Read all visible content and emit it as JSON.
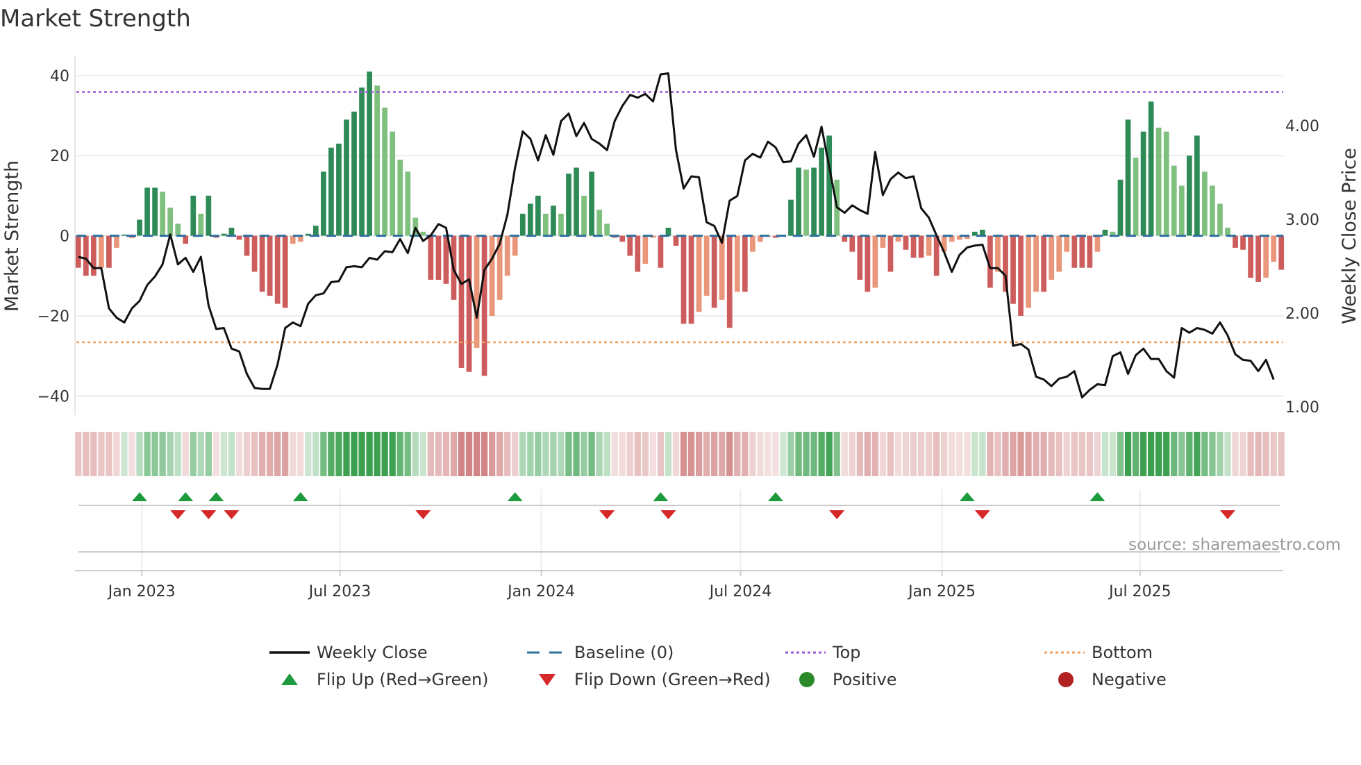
{
  "chart_data": {
    "type": "bar",
    "title": "Market Strength",
    "ylabel": "Market Strength",
    "y2label": "Weekly Close Price",
    "ylim": [
      -44.8,
      45
    ],
    "y2lim": [
      0.91,
      4.75
    ],
    "yticks": [
      40,
      20,
      0,
      -20,
      -40
    ],
    "ytick_labels": [
      "40",
      "20",
      "0",
      "−20",
      "−40"
    ],
    "y2ticks": [
      4,
      3,
      2,
      1
    ],
    "y2tick_labels": [
      "4.00",
      "3.00",
      "2.00",
      "1.00"
    ],
    "start_date": "2022-11-04",
    "frequency": "weekly",
    "xticks": [
      {
        "date": "2023-01-01",
        "label": "Jan 2023"
      },
      {
        "date": "2023-07-01",
        "label": "Jul 2023"
      },
      {
        "date": "2024-01-01",
        "label": "Jan 2024"
      },
      {
        "date": "2024-07-01",
        "label": "Jul 2024"
      },
      {
        "date": "2025-01-01",
        "label": "Jan 2025"
      },
      {
        "date": "2025-07-01",
        "label": "Jul 2025"
      }
    ],
    "top_level": 35.9,
    "bottom_level": -26.6,
    "strength": [
      -8,
      -10,
      -10,
      -8,
      -8,
      -3,
      0.3,
      -0.5,
      4,
      12,
      12,
      11,
      7,
      3,
      -2,
      10,
      5.5,
      10,
      -0.5,
      0.5,
      2,
      -1,
      -5,
      -9,
      -14,
      -15,
      -17,
      -18,
      -2,
      -1.5,
      0.5,
      2.5,
      16,
      22,
      23,
      29,
      31,
      37,
      41,
      37.5,
      32,
      26,
      19,
      16,
      4.5,
      1,
      -11,
      -11,
      -12,
      -16,
      -33,
      -34,
      -28,
      -35,
      -20,
      -16,
      -10,
      -5,
      5.5,
      8,
      10,
      5.5,
      7.5,
      5.5,
      15.5,
      17,
      10,
      16,
      6.5,
      3,
      -0.5,
      -1.5,
      -5,
      -9,
      -7,
      -0.5,
      -8,
      2,
      -2.5,
      -22,
      -22,
      -19,
      -15,
      -18,
      -16,
      -23,
      -14,
      -14,
      -4,
      -1.5,
      -0.3,
      -0.5,
      0.2,
      9,
      17,
      16.5,
      17,
      22,
      25,
      14,
      -1.5,
      -4,
      -11,
      -14,
      -13,
      -3,
      -9,
      -1.5,
      -3.5,
      -5.5,
      -5.5,
      -5,
      -10,
      -4,
      -1.5,
      -1,
      -0.8,
      1,
      1.5,
      -13,
      -9,
      -14,
      -17,
      -20,
      -18,
      -14,
      -14,
      -11,
      -9,
      -4,
      -8,
      -8,
      -8,
      -4,
      1.5,
      1,
      14,
      29,
      19.5,
      26,
      33.5,
      27,
      26,
      17.5,
      12.5,
      20,
      25,
      16,
      12.5,
      8,
      2,
      -3,
      -3.5,
      -10.5,
      -11.5,
      -10.5,
      -6.5,
      -8.5
    ],
    "close": [
      2.6,
      2.58,
      2.48,
      2.48,
      2.05,
      1.95,
      1.9,
      2.05,
      2.13,
      2.3,
      2.39,
      2.52,
      2.84,
      2.52,
      2.59,
      2.44,
      2.6,
      2.08,
      1.83,
      1.84,
      1.62,
      1.59,
      1.35,
      1.2,
      1.19,
      1.19,
      1.45,
      1.84,
      1.9,
      1.86,
      2.1,
      2.19,
      2.21,
      2.33,
      2.34,
      2.49,
      2.5,
      2.49,
      2.59,
      2.57,
      2.66,
      2.65,
      2.79,
      2.64,
      2.91,
      2.77,
      2.83,
      2.95,
      2.91,
      2.46,
      2.31,
      2.36,
      1.95,
      2.46,
      2.58,
      2.74,
      3.05,
      3.55,
      3.94,
      3.86,
      3.63,
      3.9,
      3.69,
      4.05,
      4.13,
      3.89,
      4.03,
      3.86,
      3.81,
      3.74,
      4.05,
      4.21,
      4.33,
      4.3,
      4.34,
      4.26,
      4.55,
      4.56,
      3.74,
      3.33,
      3.46,
      3.45,
      2.97,
      2.93,
      2.75,
      3.2,
      3.25,
      3.63,
      3.7,
      3.66,
      3.83,
      3.77,
      3.61,
      3.62,
      3.81,
      3.9,
      3.67,
      3.99,
      3.56,
      3.13,
      3.07,
      3.15,
      3.1,
      3.06,
      3.72,
      3.26,
      3.43,
      3.5,
      3.44,
      3.46,
      3.12,
      3.02,
      2.83,
      2.65,
      2.44,
      2.62,
      2.7,
      2.72,
      2.73,
      2.48,
      2.48,
      2.4,
      1.65,
      1.67,
      1.61,
      1.32,
      1.29,
      1.22,
      1.3,
      1.32,
      1.38,
      1.1,
      1.18,
      1.24,
      1.23,
      1.54,
      1.58,
      1.35,
      1.55,
      1.62,
      1.51,
      1.51,
      1.38,
      1.31,
      1.84,
      1.79,
      1.84,
      1.82,
      1.78,
      1.9,
      1.76,
      1.56,
      1.5,
      1.49,
      1.38,
      1.5,
      1.29
    ],
    "flip_up_weeks": [
      8,
      14,
      18,
      29,
      57,
      76,
      91,
      116,
      133
    ],
    "flip_down_weeks": [
      13,
      17,
      20,
      45,
      69,
      77,
      99,
      118,
      150
    ],
    "legend": {
      "placement": "bottom",
      "items": [
        {
          "label": "Weekly Close",
          "kind": "line",
          "color": "#111111"
        },
        {
          "label": "Baseline (0)",
          "kind": "dash",
          "color": "#2f6f9f"
        },
        {
          "label": "Top",
          "kind": "dot",
          "color": "#9b59d6"
        },
        {
          "label": "Bottom",
          "kind": "dot",
          "color": "#f0a060"
        },
        {
          "label": "Flip Up (Red→Green)",
          "kind": "up",
          "color": "#1e9a3e"
        },
        {
          "label": "Flip Down (Green→Red)",
          "kind": "down",
          "color": "#d62828"
        },
        {
          "label": "Positive",
          "kind": "circle",
          "color": "#2a8a2a"
        },
        {
          "label": "Negative",
          "kind": "circle",
          "color": "#b22222"
        }
      ]
    },
    "source": "source: sharemaestro.com",
    "colors": {
      "pos_strong": "#2e8b57",
      "pos_weak": "#7fc07f",
      "neg_strong": "#cd5c5c",
      "neg_weak": "#e9967a"
    }
  }
}
